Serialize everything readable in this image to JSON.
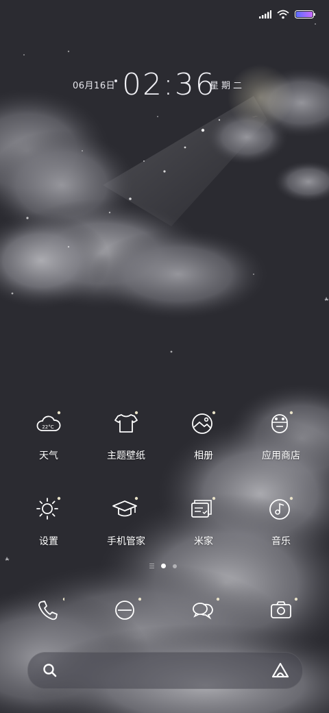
{
  "status_bar": {
    "icons": [
      "signal-icon",
      "wifi-icon",
      "battery-icon"
    ],
    "battery_gradient": [
      "#5b6cff",
      "#c86bff"
    ]
  },
  "lock_clock": {
    "date": "06月16日",
    "time": "02:36",
    "weekday": "星期二"
  },
  "apps_row1": [
    {
      "name": "weather",
      "label": "天气",
      "icon": "weather-cloud-icon",
      "temp": "22°C"
    },
    {
      "name": "themes",
      "label": "主题壁纸",
      "icon": "tshirt-icon"
    },
    {
      "name": "gallery",
      "label": "相册",
      "icon": "photo-icon"
    },
    {
      "name": "app-store",
      "label": "应用商店",
      "icon": "store-robot-icon"
    }
  ],
  "apps_row2": [
    {
      "name": "settings",
      "label": "设置",
      "icon": "sun-gear-icon"
    },
    {
      "name": "security",
      "label": "手机管家",
      "icon": "graduation-cap-icon"
    },
    {
      "name": "mi-home",
      "label": "米家",
      "icon": "cards-icon"
    },
    {
      "name": "music",
      "label": "音乐",
      "icon": "music-disc-icon"
    }
  ],
  "dock": [
    "phone-icon",
    "browser-icon",
    "messages-icon",
    "camera-icon"
  ],
  "search": {
    "left_icon": "search-icon",
    "right_icon": "assistant-icon"
  },
  "colors": {
    "background": "#2a2a30",
    "icon_stroke": "#ffffff",
    "moon": "#e9e2c8"
  }
}
